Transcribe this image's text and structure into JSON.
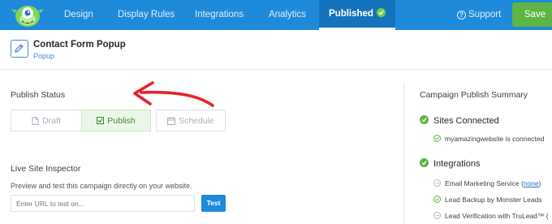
{
  "nav": {
    "items": [
      "Design",
      "Display Rules",
      "Integrations",
      "Analytics"
    ],
    "active": "Published",
    "support": "Support",
    "save": "Save"
  },
  "campaign": {
    "title": "Contact Form Popup",
    "type": "Popup"
  },
  "publish_status": {
    "label": "Publish Status",
    "options": [
      "Draft",
      "Publish",
      "Schedule"
    ],
    "selected": "Publish"
  },
  "inspector": {
    "title": "Live Site Inspector",
    "description": "Preview and test this campaign directly on your website.",
    "placeholder": "Enter URL to test on...",
    "test": "Test"
  },
  "summary": {
    "title": "Campaign Publish Summary",
    "sites_heading": "Sites Connected",
    "site": "myamazingwebsite is connected",
    "integrations_heading": "Integrations",
    "email_service": "Email Marketing Service (",
    "email_link": "none",
    "email_close": ")",
    "lead_backup": "Lead Backup by Monster Leads",
    "lead_verification": "Lead Verification with TruLead™ ("
  },
  "colors": {
    "topbar": "#1f8ad9",
    "save": "#5eb445",
    "success": "#5eb445",
    "arrow": "#e3242b"
  }
}
